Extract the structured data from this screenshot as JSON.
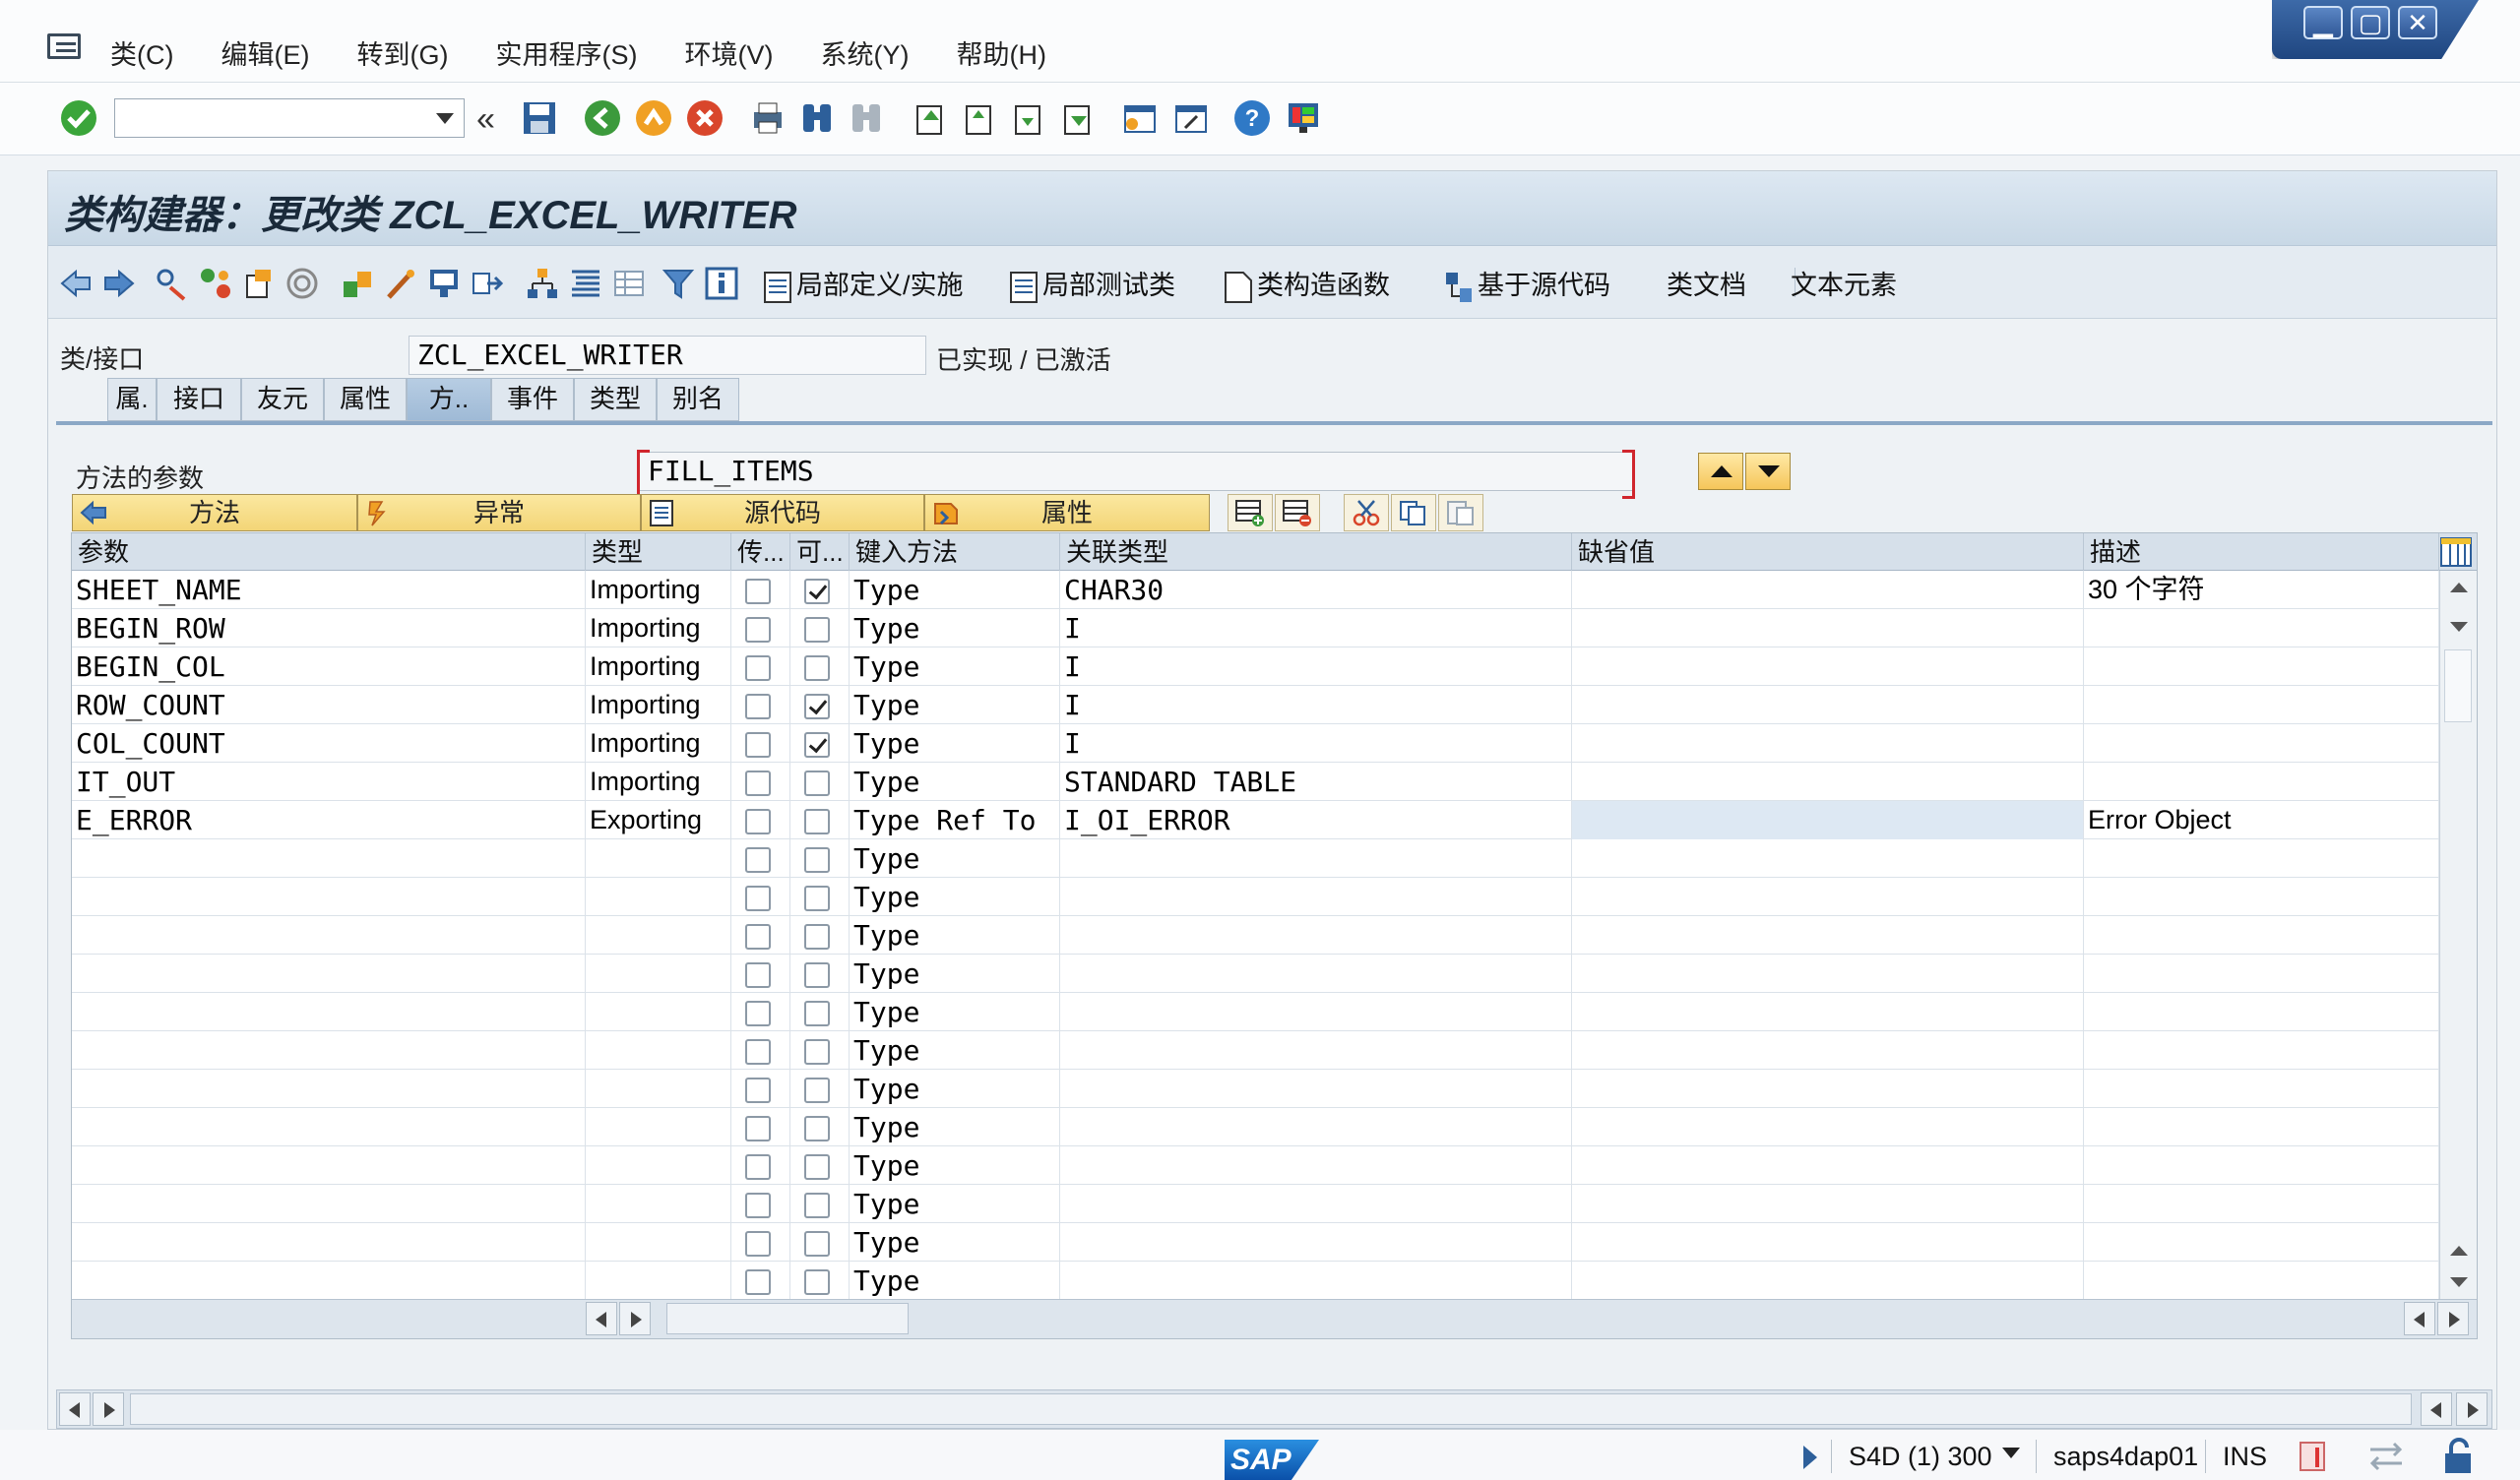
{
  "menubar": {
    "items": [
      "类(C)",
      "编辑(E)",
      "转到(G)",
      "实用程序(S)",
      "环境(V)",
      "系统(Y)",
      "帮助(H)"
    ]
  },
  "window_controls": [
    "minimize",
    "maximize",
    "close"
  ],
  "system_toolbar": {
    "command_field_value": "",
    "icons": [
      "enter-icon",
      "back-icon",
      "exit-icon",
      "cancel-icon",
      "print-icon",
      "find-icon",
      "find-next-icon",
      "first-page-icon",
      "previous-page-icon",
      "next-page-icon",
      "last-page-icon",
      "create-session-icon",
      "generate-shortcut-icon",
      "help-icon",
      "customize-layout-icon"
    ]
  },
  "title": "类构建器：更改类 ZCL_EXCEL_WRITER",
  "app_toolbar": {
    "buttons": [
      "局部定义/实施",
      "局部测试类",
      "类构造函数",
      "基于源代码",
      "类文档",
      "文本元素"
    ]
  },
  "class_row": {
    "label": "类/接口",
    "value": "ZCL_EXCEL_WRITER",
    "status": "已实现 / 已激活"
  },
  "tabs": [
    {
      "label": "属.",
      "active": false
    },
    {
      "label": "接口",
      "active": false
    },
    {
      "label": "友元",
      "active": false
    },
    {
      "label": "属性",
      "active": false
    },
    {
      "label": "方..",
      "active": true
    },
    {
      "label": "事件",
      "active": false
    },
    {
      "label": "类型",
      "active": false
    },
    {
      "label": "别名",
      "active": false
    }
  ],
  "method": {
    "label": "方法的参数",
    "value": "FILL_ITEMS"
  },
  "method_subtabs": [
    "方法",
    "异常",
    "源代码",
    "属性"
  ],
  "grid": {
    "headers": [
      "参数",
      "类型",
      "传...",
      "可...",
      "键入方法",
      "关联类型",
      "缺省值",
      "描述"
    ],
    "rows": [
      {
        "param": "SHEET_NAME",
        "type": "Importing",
        "pass": false,
        "optional": true,
        "typing": "Type",
        "ref": "CHAR30",
        "default": "",
        "desc": "30 个字符"
      },
      {
        "param": "BEGIN_ROW",
        "type": "Importing",
        "pass": false,
        "optional": false,
        "typing": "Type",
        "ref": "I",
        "default": "",
        "desc": ""
      },
      {
        "param": "BEGIN_COL",
        "type": "Importing",
        "pass": false,
        "optional": false,
        "typing": "Type",
        "ref": "I",
        "default": "",
        "desc": ""
      },
      {
        "param": "ROW_COUNT",
        "type": "Importing",
        "pass": false,
        "optional": true,
        "typing": "Type",
        "ref": "I",
        "default": "",
        "desc": ""
      },
      {
        "param": "COL_COUNT",
        "type": "Importing",
        "pass": false,
        "optional": true,
        "typing": "Type",
        "ref": "I",
        "default": "",
        "desc": ""
      },
      {
        "param": "IT_OUT",
        "type": "Importing",
        "pass": false,
        "optional": false,
        "typing": "Type",
        "ref": "STANDARD TABLE",
        "default": "",
        "desc": ""
      },
      {
        "param": "E_ERROR",
        "type": "Exporting",
        "pass": false,
        "optional": false,
        "typing": "Type Ref To",
        "ref": "I_OI_ERROR",
        "default": "",
        "desc": "Error Object"
      },
      {
        "param": "",
        "type": "",
        "pass": false,
        "optional": false,
        "typing": "Type",
        "ref": "",
        "default": "",
        "desc": ""
      },
      {
        "param": "",
        "type": "",
        "pass": false,
        "optional": false,
        "typing": "Type",
        "ref": "",
        "default": "",
        "desc": ""
      },
      {
        "param": "",
        "type": "",
        "pass": false,
        "optional": false,
        "typing": "Type",
        "ref": "",
        "default": "",
        "desc": ""
      },
      {
        "param": "",
        "type": "",
        "pass": false,
        "optional": false,
        "typing": "Type",
        "ref": "",
        "default": "",
        "desc": ""
      },
      {
        "param": "",
        "type": "",
        "pass": false,
        "optional": false,
        "typing": "Type",
        "ref": "",
        "default": "",
        "desc": ""
      },
      {
        "param": "",
        "type": "",
        "pass": false,
        "optional": false,
        "typing": "Type",
        "ref": "",
        "default": "",
        "desc": ""
      },
      {
        "param": "",
        "type": "",
        "pass": false,
        "optional": false,
        "typing": "Type",
        "ref": "",
        "default": "",
        "desc": ""
      },
      {
        "param": "",
        "type": "",
        "pass": false,
        "optional": false,
        "typing": "Type",
        "ref": "",
        "default": "",
        "desc": ""
      },
      {
        "param": "",
        "type": "",
        "pass": false,
        "optional": false,
        "typing": "Type",
        "ref": "",
        "default": "",
        "desc": ""
      },
      {
        "param": "",
        "type": "",
        "pass": false,
        "optional": false,
        "typing": "Type",
        "ref": "",
        "default": "",
        "desc": ""
      },
      {
        "param": "",
        "type": "",
        "pass": false,
        "optional": false,
        "typing": "Type",
        "ref": "",
        "default": "",
        "desc": ""
      },
      {
        "param": "",
        "type": "",
        "pass": false,
        "optional": false,
        "typing": "Type",
        "ref": "",
        "default": "",
        "desc": ""
      }
    ]
  },
  "status_bar": {
    "logo": "SAP",
    "system": "S4D (1) 300",
    "server": "saps4dap01",
    "mode": "INS"
  }
}
